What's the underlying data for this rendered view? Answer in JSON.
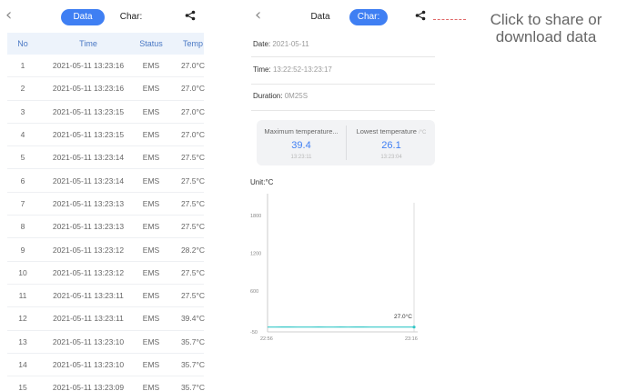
{
  "left": {
    "back_glyph": "‹",
    "tabs": [
      {
        "label": "Data",
        "active": true
      },
      {
        "label": "Char:",
        "active": false
      }
    ],
    "table": {
      "headers": [
        "No",
        "Time",
        "Status",
        "Temp"
      ],
      "rows": [
        [
          "1",
          "2021-05-11 13:23:16",
          "EMS",
          "27.0°C"
        ],
        [
          "2",
          "2021-05-11 13:23:16",
          "EMS",
          "27.0°C"
        ],
        [
          "3",
          "2021-05-11 13:23:15",
          "EMS",
          "27.0°C"
        ],
        [
          "4",
          "2021-05-11 13:23:15",
          "EMS",
          "27.0°C"
        ],
        [
          "5",
          "2021-05-11 13:23:14",
          "EMS",
          "27.5°C"
        ],
        [
          "6",
          "2021-05-11 13:23:14",
          "EMS",
          "27.5°C"
        ],
        [
          "7",
          "2021-05-11 13:23:13",
          "EMS",
          "27.5°C"
        ],
        [
          "8",
          "2021-05-11 13:23:13",
          "EMS",
          "27.5°C"
        ],
        [
          "9",
          "2021-05-11 13:23:12",
          "EMS",
          "28.2°C"
        ],
        [
          "10",
          "2021-05-11 13:23:12",
          "EMS",
          "27.5°C"
        ],
        [
          "11",
          "2021-05-11 13:23:11",
          "EMS",
          "27.5°C"
        ],
        [
          "12",
          "2021-05-11 13:23:11",
          "EMS",
          "39.4°C"
        ],
        [
          "13",
          "2021-05-11 13:23:10",
          "EMS",
          "35.7°C"
        ],
        [
          "14",
          "2021-05-11 13:23:10",
          "EMS",
          "35.7°C"
        ],
        [
          "15",
          "2021-05-11 13:23:09",
          "EMS",
          "35.7°C"
        ]
      ]
    }
  },
  "right": {
    "back_glyph": "‹",
    "tabs": [
      {
        "label": "Data",
        "active": false
      },
      {
        "label": "Char:",
        "active": true
      }
    ],
    "date_label": "Date:",
    "date_value": "2021-05-11",
    "time_label": "Time:",
    "time_value": "13:22:52-13:23:17",
    "duration_label": "Duration:",
    "duration_value": "0M25S",
    "max_label": "Maximum temperature...",
    "max_value": "39.4",
    "max_time": "13:23:11",
    "min_label": "Lowest temperature",
    "min_unit": "/°C",
    "min_value": "26.1",
    "min_time": "13:23:04",
    "unit_label": "Unit:°C"
  },
  "callout": {
    "text": "Click to share or download data"
  },
  "colors": {
    "accent": "#3f7ff3",
    "line": "#33c7c7",
    "callout_line": "#e06868"
  },
  "icons": {
    "back": "chevron-left-icon",
    "share": "share-icon"
  },
  "chart_data": {
    "type": "line",
    "title": "",
    "xlabel": "",
    "ylabel": "Unit:°C",
    "yticks": [
      "1800",
      "1200",
      "600",
      "-50"
    ],
    "ytick_values": [
      1800,
      1200,
      600,
      -50
    ],
    "xticks": [
      "22:56",
      "23:16"
    ],
    "ylim": [
      -50,
      2150
    ],
    "series": [
      {
        "values": [
          27,
          27,
          27.5,
          28,
          27,
          26.5,
          27,
          27.5,
          27,
          27,
          27.5,
          27,
          27.5,
          28,
          27,
          27,
          27,
          27,
          27,
          27,
          27
        ]
      }
    ],
    "annotation": "27.0°C",
    "grid": false
  }
}
